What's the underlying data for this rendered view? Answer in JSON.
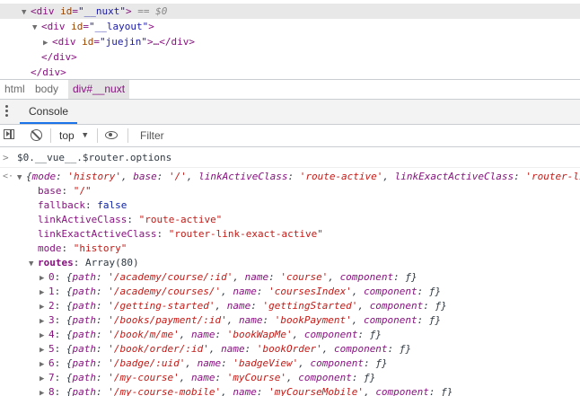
{
  "elements": {
    "lines": [
      {
        "tag_open": "<div",
        "attr": "id",
        "value": "\"__nuxt\"",
        "close": ">",
        "selected_marker": " == $0"
      },
      {
        "tag_open": "<div",
        "attr": "id",
        "value": "\"__layout\"",
        "close": ">"
      },
      {
        "tag_open": "<div",
        "attr": "id",
        "value": "\"juejin\"",
        "close": ">…</div>"
      },
      {
        "text": "</div>"
      },
      {
        "text": "</div>"
      }
    ]
  },
  "breadcrumb": [
    "html",
    "body",
    "div#__nuxt"
  ],
  "tabs": {
    "console": "Console"
  },
  "toolbar": {
    "context": "top",
    "filter_placeholder": "Filter"
  },
  "console": {
    "command_prompt": ">",
    "command": "$0.__vue__.$router.options",
    "result_prompt": "<·",
    "preview": {
      "open": "{",
      "k1": "mode",
      "v1": "'history'",
      "k2": "base",
      "v2": "'/'",
      "k3": "linkActiveClass",
      "v3": "'route-active'",
      "k4": "linkExactActiveClass",
      "v4": "'router-li"
    },
    "props": [
      {
        "key": "base",
        "value": "\"/\"",
        "kind": "str"
      },
      {
        "key": "fallback",
        "value": "false",
        "kind": "kw"
      },
      {
        "key": "linkActiveClass",
        "value": "\"route-active\"",
        "kind": "str"
      },
      {
        "key": "linkExactActiveClass",
        "value": "\"router-link-exact-active\"",
        "kind": "str"
      },
      {
        "key": "mode",
        "value": "\"history\"",
        "kind": "str"
      }
    ],
    "routes_key": "routes",
    "routes_type": "Array(80)",
    "routes": [
      {
        "i": "0",
        "path": "'/academy/course/:id'",
        "name": "'course'"
      },
      {
        "i": "1",
        "path": "'/academy/courses/'",
        "name": "'coursesIndex'"
      },
      {
        "i": "2",
        "path": "'/getting-started'",
        "name": "'gettingStarted'"
      },
      {
        "i": "3",
        "path": "'/books/payment/:id'",
        "name": "'bookPayment'"
      },
      {
        "i": "4",
        "path": "'/book/m/me'",
        "name": "'bookWapMe'"
      },
      {
        "i": "5",
        "path": "'/book/order/:id'",
        "name": "'bookOrder'"
      },
      {
        "i": "6",
        "path": "'/badge/:uid'",
        "name": "'badgeView'"
      },
      {
        "i": "7",
        "path": "'/my-course'",
        "name": "'myCourse'"
      },
      {
        "i": "8",
        "path": "'/my-course-mobile'",
        "name": "'myCourseMobile'"
      }
    ],
    "labels": {
      "path": "path",
      "name": "name",
      "component": "component",
      "f": "ƒ"
    }
  }
}
